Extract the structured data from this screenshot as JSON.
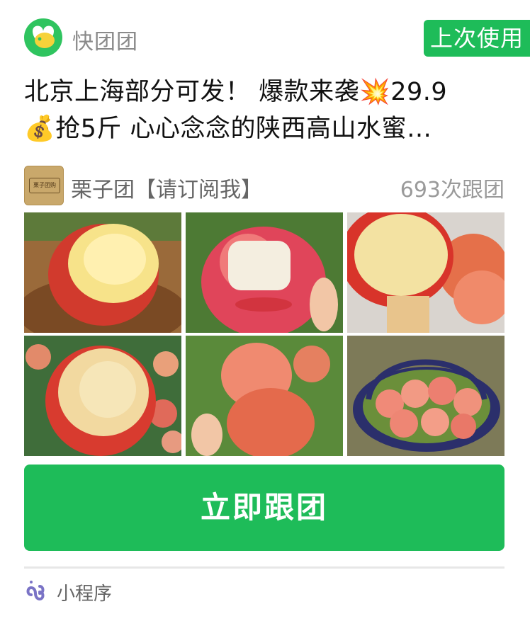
{
  "header": {
    "app_name": "快团团",
    "badge_label": "上次使用"
  },
  "post": {
    "title_line1": "北京上海部分可发！ 爆款来袭💥29.9",
    "title_line2": "💰抢5斤 心心念念的陕西高山水蜜…"
  },
  "group": {
    "name": "栗子团【请订阅我】",
    "avatar_text": "栗子团购",
    "follow_count": "693次跟团"
  },
  "gallery": {
    "items": [
      {
        "label": "peach-photo-1"
      },
      {
        "label": "peach-photo-2"
      },
      {
        "label": "peach-photo-3"
      },
      {
        "label": "peach-photo-4"
      },
      {
        "label": "peach-photo-5"
      },
      {
        "label": "peach-photo-6"
      }
    ]
  },
  "actions": {
    "follow_button": "立即跟团"
  },
  "footer": {
    "mini_program_label": "小程序",
    "mini_program_icon": "mini-program-icon"
  },
  "colors": {
    "brand_green": "#1ebc59",
    "logo_green": "#2fc45f"
  }
}
